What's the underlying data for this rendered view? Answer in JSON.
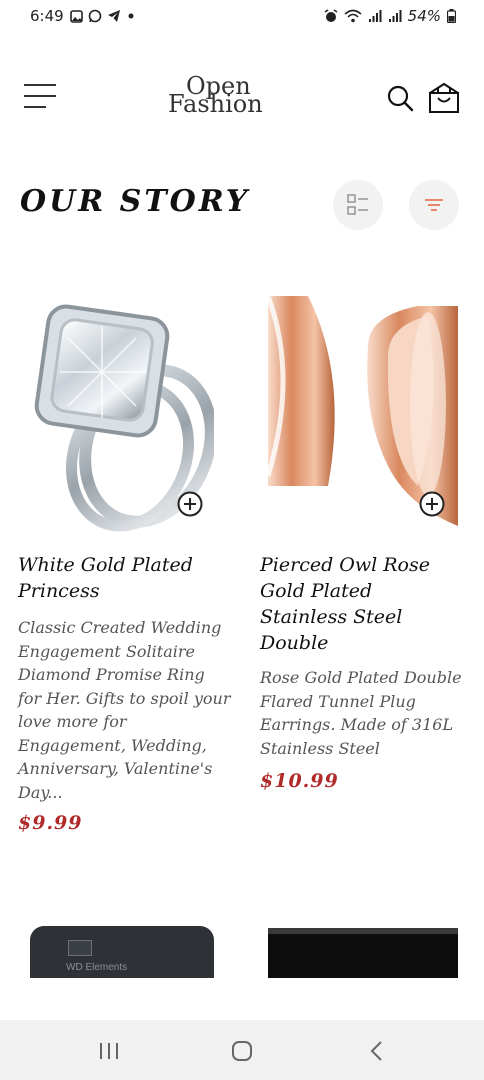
{
  "status_bar": {
    "time": "6:49",
    "battery": "54%",
    "left_icons": [
      "gallery-icon",
      "whatsapp-icon",
      "telegram-icon",
      "dot-icon"
    ],
    "right_icons": [
      "alarm-icon",
      "wifi-icon",
      "signal-icon",
      "signal-icon",
      "battery-icon"
    ]
  },
  "header": {
    "logo_line1": "Open",
    "logo_line2": "Fashion",
    "menu_icon": "hamburger-icon",
    "search_icon": "search-icon",
    "cart_icon": "shopping-bag-icon"
  },
  "section": {
    "title": "OUR STORY",
    "view_toggle_icon": "list-view-icon",
    "filter_icon": "filter-icon",
    "accent_color": "#e8795a"
  },
  "products": [
    {
      "title": "White Gold Plated Princess",
      "description": "Classic Created Wedding Engagement Solitaire Diamond Promise Ring for Her. Gifts to spoil your love more for Engagement, Wedding, Anniversary, Valentine's Day...",
      "price": "$9.99"
    },
    {
      "title": "Pierced Owl Rose Gold Plated Stainless Steel Double",
      "description": "Rose Gold Plated Double Flared Tunnel Plug Earrings. Made of 316L Stainless Steel",
      "price": "$10.99"
    }
  ],
  "partial_products": [
    {
      "image_text": "WD Elements"
    }
  ],
  "navbar": {
    "icons": [
      "recent-apps-icon",
      "home-icon",
      "back-icon"
    ]
  }
}
